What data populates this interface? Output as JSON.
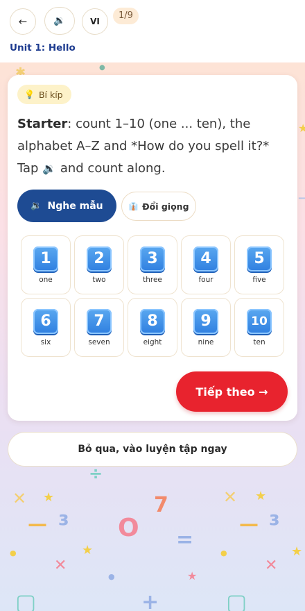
{
  "header": {
    "back_icon": "←",
    "sound_icon": "🔉",
    "language_code": "VI",
    "progress": "1/9",
    "unit_title": "Unit 1: Hello"
  },
  "card": {
    "tip_label": "Bí kíp",
    "tip_icon": "💡",
    "description": {
      "bold": "Starter",
      "part1": ": count 1–10 (one ... ten), the alphabet A–Z and *How do you spell it?* Tap ",
      "speaker_icon": "🔉",
      "part2": " and count along."
    },
    "listen_button": {
      "icon": "🔉",
      "label": "Nghe mẫu"
    },
    "voice_button": {
      "icon": "👔",
      "label": "Đổi giọng"
    },
    "numbers": [
      {
        "digit": "1",
        "word": "one"
      },
      {
        "digit": "2",
        "word": "two"
      },
      {
        "digit": "3",
        "word": "three"
      },
      {
        "digit": "4",
        "word": "four"
      },
      {
        "digit": "5",
        "word": "five"
      },
      {
        "digit": "6",
        "word": "six"
      },
      {
        "digit": "7",
        "word": "seven"
      },
      {
        "digit": "8",
        "word": "eight"
      },
      {
        "digit": "9",
        "word": "nine"
      },
      {
        "digit": "10",
        "word": "ten"
      }
    ],
    "next_button": "Tiếp theo →"
  },
  "skip_button": "Bỏ qua, vào luyện tập ngay",
  "colors": {
    "primary_blue": "#1e4b93",
    "accent_red": "#e8232e",
    "title_blue": "#1d3b8f"
  }
}
